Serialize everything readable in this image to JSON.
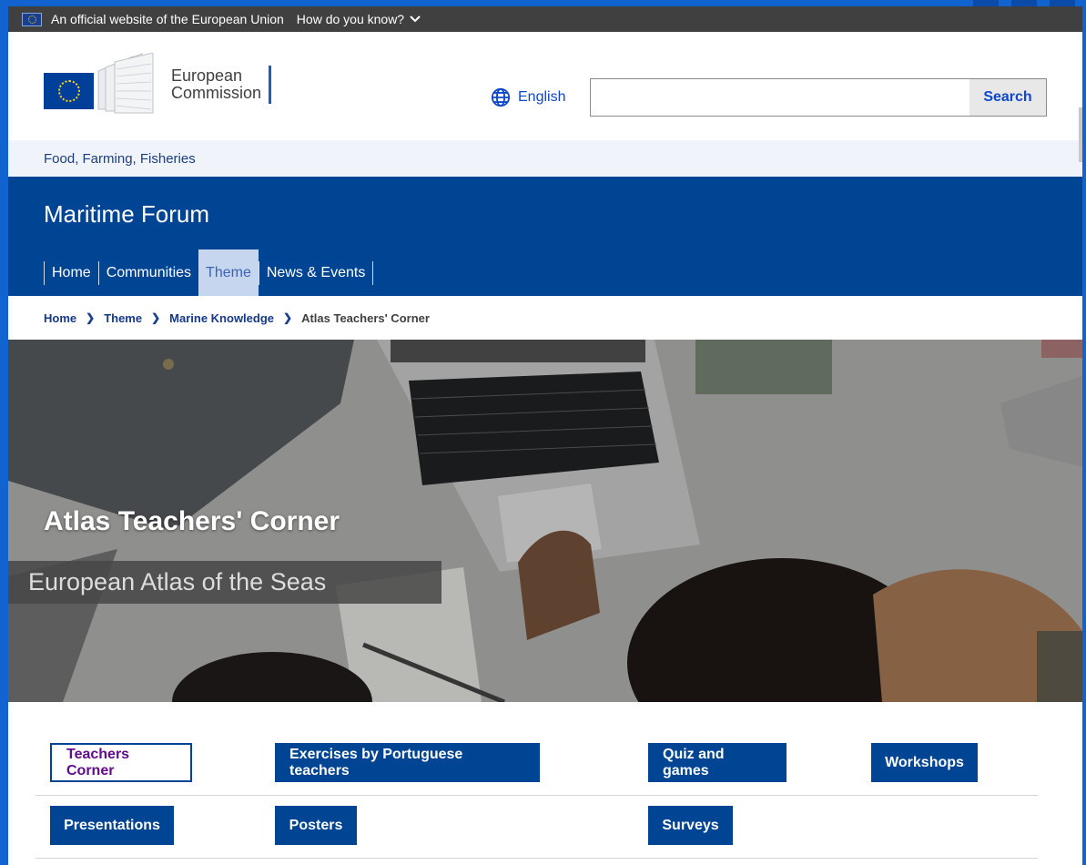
{
  "eu_bar": {
    "official_text": "An official website of the European Union",
    "how_label": "How do you know?"
  },
  "header": {
    "logo_line1": "European",
    "logo_line2": "Commission",
    "language_label": "English",
    "search_placeholder": "",
    "search_button": "Search"
  },
  "context": {
    "site_label": "Food, Farming, Fisheries"
  },
  "site": {
    "title": "Maritime Forum",
    "nav": [
      {
        "label": "Home"
      },
      {
        "label": "Communities"
      },
      {
        "label": "Theme"
      },
      {
        "label": "News & Events"
      }
    ]
  },
  "breadcrumb": {
    "items": [
      "Home",
      "Theme",
      "Marine Knowledge"
    ],
    "current": "Atlas Teachers' Corner"
  },
  "hero": {
    "title": "Atlas Teachers' Corner",
    "subtitle": "European Atlas of the Seas"
  },
  "buttons": {
    "teachers_corner": "Teachers Corner",
    "exercises": "Exercises by Portuguese teachers",
    "quiz": "Quiz and games",
    "workshops": "Workshops",
    "presentations": "Presentations",
    "posters": "Posters",
    "surveys": "Surveys"
  },
  "colors": {
    "eu_blue": "#004494",
    "page_border": "#1163cf",
    "top_bar": "#404040",
    "active_tab": "#c5d6ee"
  }
}
